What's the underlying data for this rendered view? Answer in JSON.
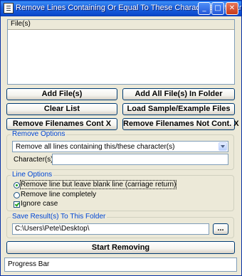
{
  "window": {
    "title": "Remove Lines Containing Or Equal To These Characters Software"
  },
  "file_list": {
    "header": "File(s)"
  },
  "buttons": {
    "add_files": "Add File(s)",
    "add_all_in_folder": "Add All File(s) In Folder",
    "clear_list": "Clear List",
    "load_sample": "Load Sample/Example Files",
    "remove_filenames_cont": "Remove Filenames Cont X",
    "remove_filenames_not_cont": "Remove Filenames Not Cont. X",
    "browse": "...",
    "start_removing": "Start Removing"
  },
  "remove_options": {
    "legend": "Remove Options",
    "mode_selected": "Remove all lines containing this/these character(s)",
    "characters_label": "Character(s):",
    "characters_value": ""
  },
  "line_options": {
    "legend": "Line Options",
    "options": [
      {
        "label": "Remove line but leave blank line (carriage return)",
        "checked": true
      },
      {
        "label": "Remove line completely",
        "checked": false
      }
    ],
    "ignore_case": {
      "label": "Ignore case",
      "checked": true
    }
  },
  "save_results": {
    "legend": "Save Result(s) To This Folder",
    "folder_path": "C:\\Users\\Pete\\Desktop\\"
  },
  "progress": {
    "label": "Progress Bar",
    "value": 0
  },
  "colors": {
    "title_bar": "#0a5ce4",
    "window_bg": "#ece9d8",
    "group_legend": "#0046d5",
    "close_button": "#c73a1a"
  }
}
